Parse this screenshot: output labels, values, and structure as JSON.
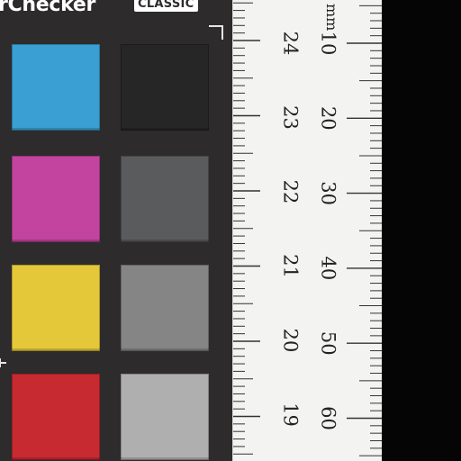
{
  "brand": {
    "wordmark": "rChecker",
    "edition": "CLASSIC"
  },
  "swatches": [
    {
      "name": "cyan",
      "color": "#3a9fd2"
    },
    {
      "name": "black",
      "color": "#262626"
    },
    {
      "name": "magenta",
      "color": "#c2449f"
    },
    {
      "name": "dark-gray",
      "color": "#5a5b5d"
    },
    {
      "name": "yellow",
      "color": "#e4c83a"
    },
    {
      "name": "mid-gray",
      "color": "#858586"
    },
    {
      "name": "red",
      "color": "#c72a30"
    },
    {
      "name": "light-gray",
      "color": "#afafb0"
    }
  ],
  "ruler": {
    "unit": "mm",
    "inner_scale_labels": [
      "24",
      "23",
      "22",
      "21",
      "20",
      "19"
    ],
    "outer_scale_labels": [
      "10",
      "20",
      "30",
      "40",
      "50",
      "60"
    ]
  },
  "colors": {
    "card": "#2d2b2c",
    "ruler": "#f3f3f1",
    "tick": "#333333",
    "backdrop": "#050505"
  }
}
